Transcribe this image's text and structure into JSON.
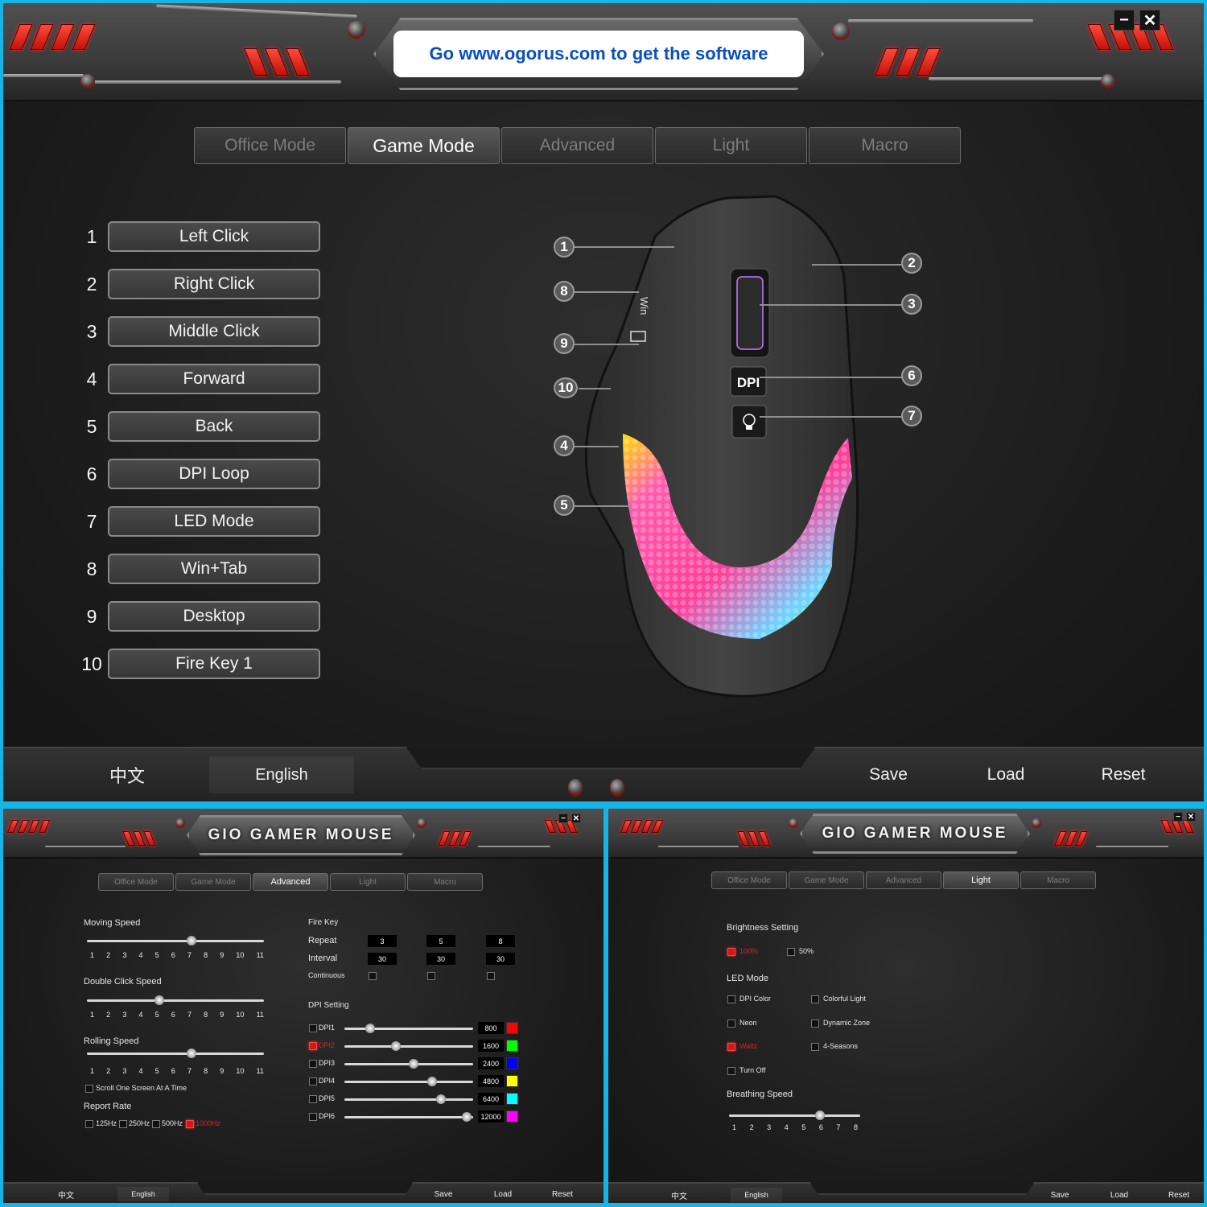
{
  "main": {
    "banner": "Go www.ogorus.com to get the software",
    "window_controls": {
      "minimize": "−",
      "close": "✕"
    },
    "tabs": [
      {
        "label": "Office Mode",
        "active": false
      },
      {
        "label": "Game Mode",
        "active": true
      },
      {
        "label": "Advanced",
        "active": false
      },
      {
        "label": "Light",
        "active": false
      },
      {
        "label": "Macro",
        "active": false
      }
    ],
    "keys": [
      {
        "num": "1",
        "label": "Left Click"
      },
      {
        "num": "2",
        "label": "Right Click"
      },
      {
        "num": "3",
        "label": "Middle Click"
      },
      {
        "num": "4",
        "label": "Forward"
      },
      {
        "num": "5",
        "label": "Back"
      },
      {
        "num": "6",
        "label": "DPI Loop"
      },
      {
        "num": "7",
        "label": "LED Mode"
      },
      {
        "num": "8",
        "label": "Win+Tab"
      },
      {
        "num": "9",
        "label": "Desktop"
      },
      {
        "num": "10",
        "label": "Fire Key 1"
      }
    ],
    "mouse": {
      "callouts_left": [
        "1",
        "8",
        "9",
        "10",
        "4",
        "5"
      ],
      "callouts_right": [
        "2",
        "3",
        "6",
        "7"
      ],
      "button_labels": {
        "win": "Win",
        "dpi": "DPI"
      }
    },
    "footer": {
      "chinese": "中文",
      "english": "English",
      "save": "Save",
      "load": "Load",
      "reset": "Reset"
    }
  },
  "advanced_window": {
    "title": "GIO GAMER MOUSE",
    "window_controls": {
      "minimize": "−",
      "close": "✕"
    },
    "tabs": [
      {
        "label": "Office Mode",
        "active": false
      },
      {
        "label": "Game Mode",
        "active": false
      },
      {
        "label": "Advanced",
        "active": true
      },
      {
        "label": "Light",
        "active": false
      },
      {
        "label": "Macro",
        "active": false
      }
    ],
    "moving_speed": {
      "label": "Moving Speed",
      "ticks": [
        "1",
        "2",
        "3",
        "4",
        "5",
        "6",
        "7",
        "8",
        "9",
        "10",
        "11"
      ],
      "value": 7
    },
    "double_click_speed": {
      "label": "Double Click Speed",
      "ticks": [
        "1",
        "2",
        "3",
        "4",
        "5",
        "6",
        "7",
        "8",
        "9",
        "10",
        "11"
      ],
      "value": 5
    },
    "rolling_speed": {
      "label": "Rolling Speed",
      "ticks": [
        "1",
        "2",
        "3",
        "4",
        "5",
        "6",
        "7",
        "8",
        "9",
        "10",
        "11"
      ],
      "value": 7
    },
    "scroll_one_screen": {
      "label": "Scroll One Screen At A Time",
      "checked": false
    },
    "report_rate": {
      "label": "Report Rate",
      "options": [
        {
          "label": "125Hz",
          "selected": false
        },
        {
          "label": "250Hz",
          "selected": false
        },
        {
          "label": "500Hz",
          "selected": false
        },
        {
          "label": "1000Hz",
          "selected": true
        }
      ]
    },
    "fire_key": {
      "label": "Fire Key",
      "repeat_label": "Repeat",
      "interval_label": "Interval",
      "continuous_label": "Continuous",
      "repeat": [
        "3",
        "5",
        "8"
      ],
      "interval": [
        "30",
        "30",
        "30"
      ],
      "continuous": [
        false,
        false,
        false
      ]
    },
    "dpi_setting": {
      "label": "DPI Setting",
      "max": 12000,
      "levels": [
        {
          "label": "DPI1",
          "value": "800",
          "fraction": 0.2,
          "color": "#ff0000",
          "checked": false
        },
        {
          "label": "DPI2",
          "value": "1600",
          "fraction": 0.4,
          "color": "#00ff00",
          "checked": true
        },
        {
          "label": "DPI3",
          "value": "2400",
          "fraction": 0.54,
          "color": "#0000ff",
          "checked": false
        },
        {
          "label": "DPI4",
          "value": "4800",
          "fraction": 0.68,
          "color": "#ffff00",
          "checked": false
        },
        {
          "label": "DPI5",
          "value": "6400",
          "fraction": 0.75,
          "color": "#00ffff",
          "checked": false
        },
        {
          "label": "DPI6",
          "value": "12000",
          "fraction": 0.95,
          "color": "#ff00ff",
          "checked": false
        }
      ]
    },
    "footer": {
      "chinese": "中文",
      "english": "English",
      "save": "Save",
      "load": "Load",
      "reset": "Reset"
    }
  },
  "light_window": {
    "title": "GIO GAMER MOUSE",
    "window_controls": {
      "minimize": "−",
      "close": "✕"
    },
    "tabs": [
      {
        "label": "Office Mode",
        "active": false
      },
      {
        "label": "Game Mode",
        "active": false
      },
      {
        "label": "Advanced",
        "active": false
      },
      {
        "label": "Light",
        "active": true
      },
      {
        "label": "Macro",
        "active": false
      }
    ],
    "brightness": {
      "label": "Brightness Setting",
      "options": [
        {
          "label": "100%",
          "selected": true
        },
        {
          "label": "50%",
          "selected": false
        }
      ]
    },
    "led_mode": {
      "label": "LED Mode",
      "options": [
        {
          "label": "DPI Color",
          "selected": false
        },
        {
          "label": "Colorful Light",
          "selected": false
        },
        {
          "label": "Neon",
          "selected": false
        },
        {
          "label": "Dynamic Zone",
          "selected": false
        },
        {
          "label": "Waltz",
          "selected": true
        },
        {
          "label": "4-Seasons",
          "selected": false
        },
        {
          "label": "Turn Off",
          "selected": false
        }
      ]
    },
    "breathing_speed": {
      "label": "Breathing Speed",
      "ticks": [
        "1",
        "2",
        "3",
        "4",
        "5",
        "6",
        "7",
        "8"
      ],
      "value": 6
    },
    "footer": {
      "chinese": "中文",
      "english": "English",
      "save": "Save",
      "load": "Load",
      "reset": "Reset"
    }
  }
}
